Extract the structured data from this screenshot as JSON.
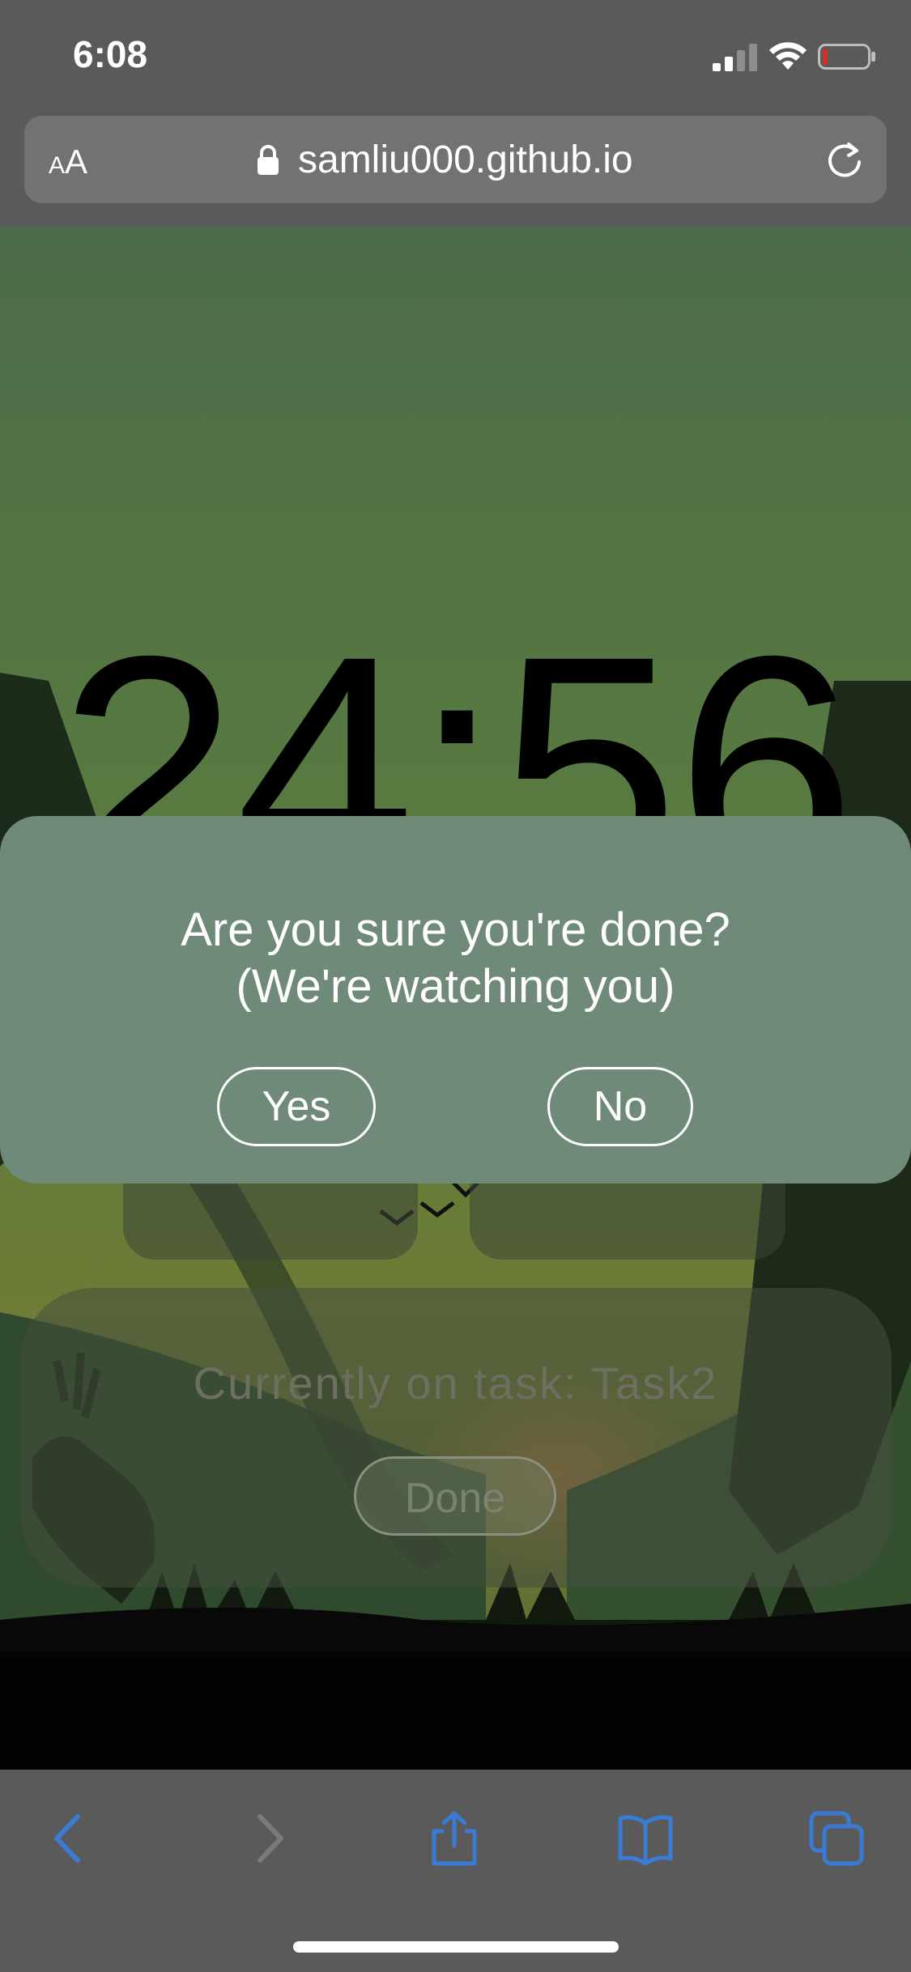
{
  "status_bar": {
    "time": "6:08",
    "icons": [
      "cellular-signal-icon",
      "wifi-icon",
      "battery-low-icon"
    ]
  },
  "address_bar": {
    "text_size_small": "A",
    "text_size_large": "A",
    "url": "samliu000.github.io",
    "icons": [
      "lock-icon",
      "reload-icon"
    ]
  },
  "page": {
    "timer": "24:56",
    "task_label": "Currently on task: Task2",
    "done_label": "Done"
  },
  "dialog": {
    "line1": "Are you sure you're done?",
    "line2": "(We're watching you)",
    "yes_label": "Yes",
    "no_label": "No"
  },
  "toolbar": {
    "icons": [
      "back-icon",
      "forward-icon",
      "share-icon",
      "bookmarks-icon",
      "tabs-icon"
    ]
  },
  "colors": {
    "browser_chrome": "#5a5a5a",
    "address_field": "#727272",
    "dialog_background": "#6f8a79",
    "toolbar_accent": "#3a7bd5",
    "battery_low": "#d0302a"
  }
}
